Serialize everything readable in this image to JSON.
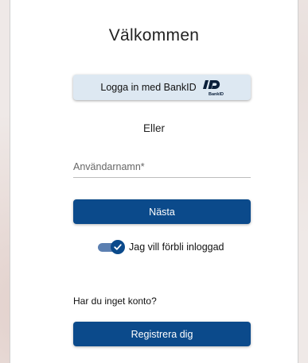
{
  "login": {
    "title": "Välkommen",
    "bankid_button_label": "Logga in med BankID",
    "bankid_logo_text": "BankID",
    "or_label": "Eller",
    "username_placeholder": "Användarnamn*",
    "username_value": "",
    "next_button_label": "Nästa",
    "remember_me_label": "Jag vill förbli inloggad",
    "remember_me_checked": true,
    "no_account_text": "Har du inget konto?",
    "register_button_label": "Registrera dig"
  },
  "colors": {
    "primary": "#0b4a8b",
    "bankid_button_bg": "#dde8f2",
    "toggle_track": "#5b7fb1",
    "card_bg": "#ffffff"
  },
  "icons": {
    "bankid": "bankid-logo-icon",
    "toggle_check": "check-icon"
  }
}
